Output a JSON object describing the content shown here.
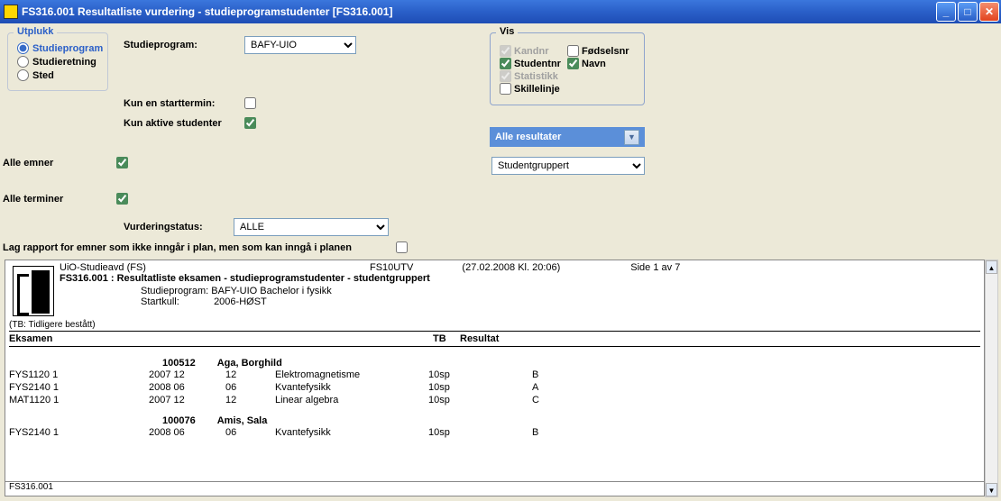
{
  "window": {
    "title": "FS316.001 Resultatliste vurdering - studieprogramstudenter [FS316.001]"
  },
  "utplukk": {
    "legend": "Utplukk",
    "opt1": "Studieprogram",
    "opt2": "Studieretning",
    "opt3": "Sted"
  },
  "vis": {
    "legend": "Vis",
    "kandnr": "Kandnr",
    "fodselsnr": "Fødselsnr",
    "studentnr": "Studentnr",
    "navn": "Navn",
    "statistikk": "Statistikk",
    "skillelinje": "Skillelinje"
  },
  "labels": {
    "studieprogram": "Studieprogram:",
    "kun_starttermin": "Kun en starttermin:",
    "kun_aktive": "Kun aktive studenter",
    "alle_emner": "Alle emner",
    "alle_terminer": "Alle terminer",
    "vurderingstatus": "Vurderingstatus:",
    "lag_rapport": "Lag rapport for emner som ikke inngår i plan, men som kan inngå i planen"
  },
  "selects": {
    "studieprogram": "BAFY-UIO",
    "alle_resultater": "Alle resultater",
    "studentgruppert": "Studentgruppert",
    "vurderingstatus": "ALLE"
  },
  "report": {
    "org": "UiO-Studieavd (FS)",
    "sys": "FS10UTV",
    "timestamp": "(27.02.2008 Kl. 20:06)",
    "page": "Side 1 av 7",
    "title": "FS316.001 : Resultatliste eksamen - studieprogramstudenter - studentgruppert",
    "sp_label": "Studieprogram:",
    "sp_value": "BAFY-UIO Bachelor i fysikk",
    "sk_label": "Startkull:",
    "sk_value": "2006-HØST",
    "tb_note": "(TB: Tidligere bestått)",
    "col_eksamen": "Eksamen",
    "col_tb": "TB",
    "col_resultat": "Resultat",
    "student1_nr": "100512",
    "student1_name": "Aga, Borghild",
    "student2_nr": "100076",
    "student2_name": "Amis, Sala",
    "rows": [
      {
        "code": "FYS1120 1",
        "term": "2007 12",
        "mnd": "12",
        "subj": "Elektromagnetisme",
        "sp": "10sp",
        "grade": "B"
      },
      {
        "code": "FYS2140 1",
        "term": "2008 06",
        "mnd": "06",
        "subj": "Kvantefysikk",
        "sp": "10sp",
        "grade": "A"
      },
      {
        "code": "MAT1120 1",
        "term": "2007 12",
        "mnd": "12",
        "subj": "Linear algebra",
        "sp": "10sp",
        "grade": "C"
      }
    ],
    "row4": {
      "code": "FYS2140 1",
      "term": "2008 06",
      "mnd": "06",
      "subj": "Kvantefysikk",
      "sp": "10sp",
      "grade": "B"
    },
    "status": "FS316.001"
  }
}
